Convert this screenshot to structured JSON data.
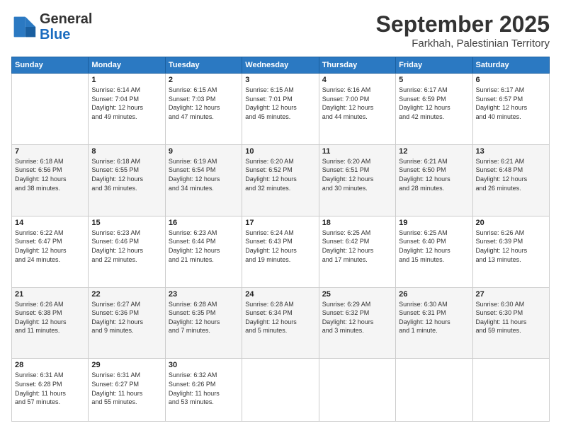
{
  "header": {
    "logo": {
      "line1": "General",
      "line2": "Blue"
    },
    "month_title": "September 2025",
    "subtitle": "Farkhah, Palestinian Territory"
  },
  "days_of_week": [
    "Sunday",
    "Monday",
    "Tuesday",
    "Wednesday",
    "Thursday",
    "Friday",
    "Saturday"
  ],
  "weeks": [
    [
      {
        "num": "",
        "info": ""
      },
      {
        "num": "1",
        "info": "Sunrise: 6:14 AM\nSunset: 7:04 PM\nDaylight: 12 hours\nand 49 minutes."
      },
      {
        "num": "2",
        "info": "Sunrise: 6:15 AM\nSunset: 7:03 PM\nDaylight: 12 hours\nand 47 minutes."
      },
      {
        "num": "3",
        "info": "Sunrise: 6:15 AM\nSunset: 7:01 PM\nDaylight: 12 hours\nand 45 minutes."
      },
      {
        "num": "4",
        "info": "Sunrise: 6:16 AM\nSunset: 7:00 PM\nDaylight: 12 hours\nand 44 minutes."
      },
      {
        "num": "5",
        "info": "Sunrise: 6:17 AM\nSunset: 6:59 PM\nDaylight: 12 hours\nand 42 minutes."
      },
      {
        "num": "6",
        "info": "Sunrise: 6:17 AM\nSunset: 6:57 PM\nDaylight: 12 hours\nand 40 minutes."
      }
    ],
    [
      {
        "num": "7",
        "info": "Sunrise: 6:18 AM\nSunset: 6:56 PM\nDaylight: 12 hours\nand 38 minutes."
      },
      {
        "num": "8",
        "info": "Sunrise: 6:18 AM\nSunset: 6:55 PM\nDaylight: 12 hours\nand 36 minutes."
      },
      {
        "num": "9",
        "info": "Sunrise: 6:19 AM\nSunset: 6:54 PM\nDaylight: 12 hours\nand 34 minutes."
      },
      {
        "num": "10",
        "info": "Sunrise: 6:20 AM\nSunset: 6:52 PM\nDaylight: 12 hours\nand 32 minutes."
      },
      {
        "num": "11",
        "info": "Sunrise: 6:20 AM\nSunset: 6:51 PM\nDaylight: 12 hours\nand 30 minutes."
      },
      {
        "num": "12",
        "info": "Sunrise: 6:21 AM\nSunset: 6:50 PM\nDaylight: 12 hours\nand 28 minutes."
      },
      {
        "num": "13",
        "info": "Sunrise: 6:21 AM\nSunset: 6:48 PM\nDaylight: 12 hours\nand 26 minutes."
      }
    ],
    [
      {
        "num": "14",
        "info": "Sunrise: 6:22 AM\nSunset: 6:47 PM\nDaylight: 12 hours\nand 24 minutes."
      },
      {
        "num": "15",
        "info": "Sunrise: 6:23 AM\nSunset: 6:46 PM\nDaylight: 12 hours\nand 22 minutes."
      },
      {
        "num": "16",
        "info": "Sunrise: 6:23 AM\nSunset: 6:44 PM\nDaylight: 12 hours\nand 21 minutes."
      },
      {
        "num": "17",
        "info": "Sunrise: 6:24 AM\nSunset: 6:43 PM\nDaylight: 12 hours\nand 19 minutes."
      },
      {
        "num": "18",
        "info": "Sunrise: 6:25 AM\nSunset: 6:42 PM\nDaylight: 12 hours\nand 17 minutes."
      },
      {
        "num": "19",
        "info": "Sunrise: 6:25 AM\nSunset: 6:40 PM\nDaylight: 12 hours\nand 15 minutes."
      },
      {
        "num": "20",
        "info": "Sunrise: 6:26 AM\nSunset: 6:39 PM\nDaylight: 12 hours\nand 13 minutes."
      }
    ],
    [
      {
        "num": "21",
        "info": "Sunrise: 6:26 AM\nSunset: 6:38 PM\nDaylight: 12 hours\nand 11 minutes."
      },
      {
        "num": "22",
        "info": "Sunrise: 6:27 AM\nSunset: 6:36 PM\nDaylight: 12 hours\nand 9 minutes."
      },
      {
        "num": "23",
        "info": "Sunrise: 6:28 AM\nSunset: 6:35 PM\nDaylight: 12 hours\nand 7 minutes."
      },
      {
        "num": "24",
        "info": "Sunrise: 6:28 AM\nSunset: 6:34 PM\nDaylight: 12 hours\nand 5 minutes."
      },
      {
        "num": "25",
        "info": "Sunrise: 6:29 AM\nSunset: 6:32 PM\nDaylight: 12 hours\nand 3 minutes."
      },
      {
        "num": "26",
        "info": "Sunrise: 6:30 AM\nSunset: 6:31 PM\nDaylight: 12 hours\nand 1 minute."
      },
      {
        "num": "27",
        "info": "Sunrise: 6:30 AM\nSunset: 6:30 PM\nDaylight: 11 hours\nand 59 minutes."
      }
    ],
    [
      {
        "num": "28",
        "info": "Sunrise: 6:31 AM\nSunset: 6:28 PM\nDaylight: 11 hours\nand 57 minutes."
      },
      {
        "num": "29",
        "info": "Sunrise: 6:31 AM\nSunset: 6:27 PM\nDaylight: 11 hours\nand 55 minutes."
      },
      {
        "num": "30",
        "info": "Sunrise: 6:32 AM\nSunset: 6:26 PM\nDaylight: 11 hours\nand 53 minutes."
      },
      {
        "num": "",
        "info": ""
      },
      {
        "num": "",
        "info": ""
      },
      {
        "num": "",
        "info": ""
      },
      {
        "num": "",
        "info": ""
      }
    ]
  ]
}
